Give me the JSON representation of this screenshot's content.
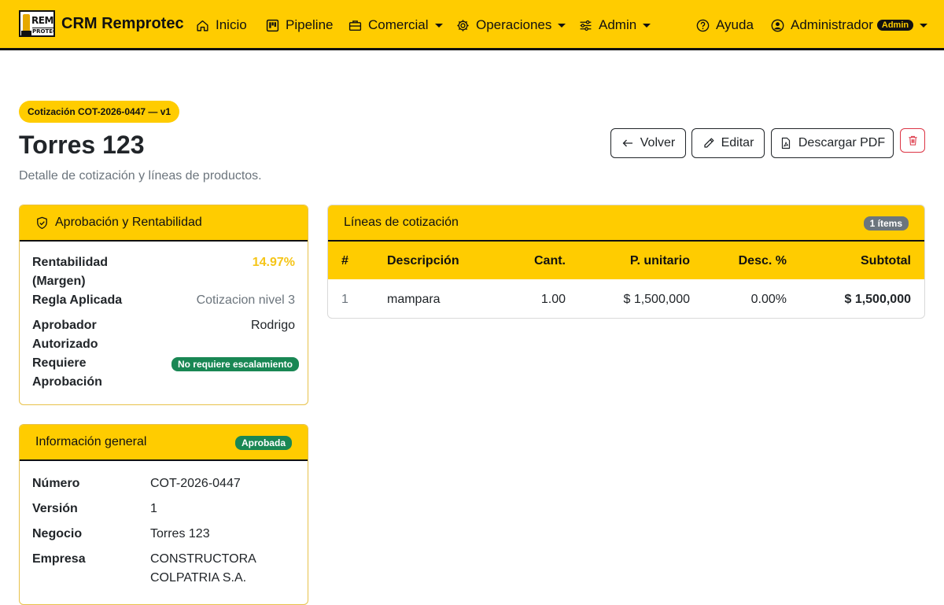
{
  "nav": {
    "brand_logo_top": "REM",
    "brand_logo_bottom": "PROTEC",
    "brand": "CRM Remprotec",
    "items": [
      {
        "label": "Inicio",
        "icon": "home-icon"
      },
      {
        "label": "Pipeline",
        "icon": "kanban-icon"
      },
      {
        "label": "Comercial",
        "icon": "briefcase-icon",
        "dropdown": true
      },
      {
        "label": "Operaciones",
        "icon": "gear-icon",
        "dropdown": true
      },
      {
        "label": "Admin",
        "icon": "sliders-icon",
        "dropdown": true
      }
    ],
    "help": "Ayuda",
    "user": "Administrador",
    "user_badge": "Admin"
  },
  "header": {
    "pill": "Cotización COT-2026-0447 — v1",
    "title": "Torres 123",
    "subtitle": "Detalle de cotización y líneas de productos.",
    "buttons": {
      "back": "Volver",
      "edit": "Editar",
      "pdf": "Descargar PDF"
    }
  },
  "approval": {
    "title": "Aprobación y Rentabilidad",
    "rentabilidad_label_1": "Rentabilidad",
    "rentabilidad_label_2": "(Margen)",
    "rentabilidad_value": "14.97%",
    "regla_label": "Regla Aplicada",
    "regla_value": "Cotizacion nivel 3",
    "aprobador_label_1": "Aprobador",
    "aprobador_label_2": "Autorizado",
    "aprobador_value": "Rodrigo",
    "requiere_label_1": "Requiere",
    "requiere_label_2": "Aprobación",
    "requiere_value": "No requiere escalamiento"
  },
  "general": {
    "title": "Información general",
    "status": "Aprobada",
    "numero_label": "Número",
    "numero_value": "COT-2026-0447",
    "version_label": "Versión",
    "version_value": "1",
    "negocio_label": "Negocio",
    "negocio_value": "Torres 123",
    "empresa_label": "Empresa",
    "empresa_value_1": "CONSTRUCTORA",
    "empresa_value_2": "COLPATRIA S.A."
  },
  "lines": {
    "title": "Líneas de cotización",
    "count_badge": "1 ítems",
    "columns": {
      "num": "#",
      "desc": "Descripción",
      "qty": "Cant.",
      "unit": "P. unitario",
      "disc": "Desc. %",
      "subtotal": "Subtotal"
    },
    "rows": [
      {
        "num": "1",
        "desc": "mampara",
        "qty": "1.00",
        "unit": "$ 1,500,000",
        "disc": "0.00%",
        "subtotal": "$ 1,500,000"
      }
    ]
  },
  "colors": {
    "accent": "#FFCC00",
    "success": "#198754",
    "danger": "#dc3545",
    "muted": "#6c757d"
  }
}
